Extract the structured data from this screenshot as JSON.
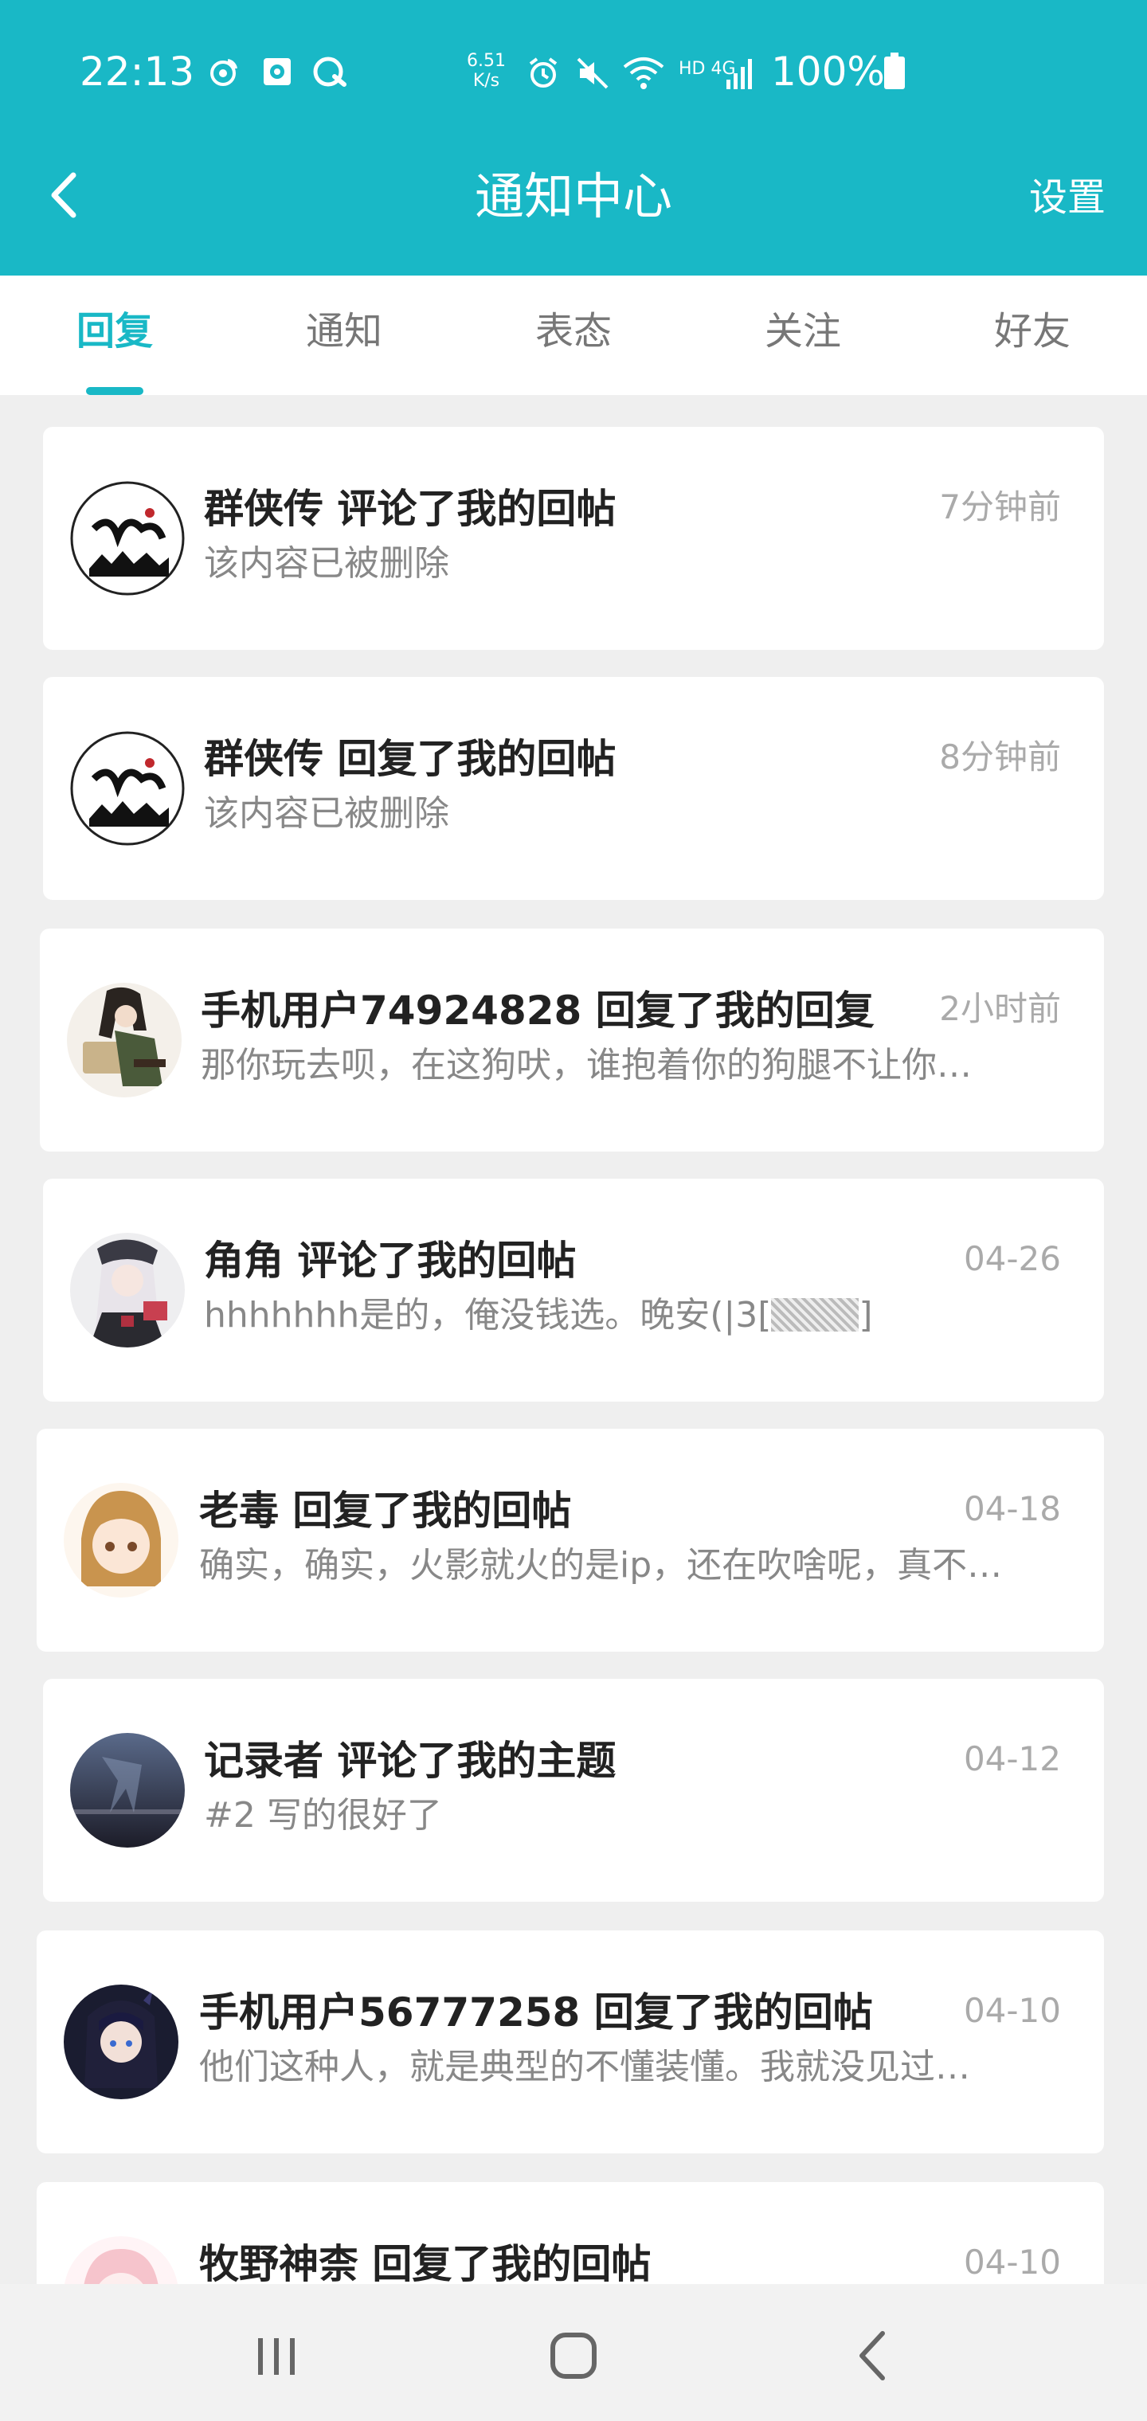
{
  "status_bar": {
    "time": "22:13",
    "net_speed_value": "6.51",
    "net_speed_unit": "K/s",
    "network_label": "HD 4G",
    "battery": "100%",
    "icons": [
      "weibo-icon",
      "gallery-icon",
      "qq-icon",
      "alarm-icon",
      "mute-icon",
      "wifi-icon",
      "signal-icon",
      "battery-icon"
    ]
  },
  "header": {
    "title": "通知中心",
    "back_icon": "chevron-left-icon",
    "settings_label": "设置"
  },
  "tabs": [
    {
      "label": "回复",
      "active": true
    },
    {
      "label": "通知",
      "active": false
    },
    {
      "label": "表态",
      "active": false
    },
    {
      "label": "关注",
      "active": false
    },
    {
      "label": "好友",
      "active": false
    }
  ],
  "notifications": [
    {
      "title": "群侠传 评论了我的回帖",
      "time": "7分钟前",
      "body": "该内容已被删除",
      "avatar": "qunxiazhuan-logo-avatar"
    },
    {
      "title": "群侠传 回复了我的回帖",
      "time": "8分钟前",
      "body": "该内容已被删除",
      "avatar": "qunxiazhuan-logo-avatar"
    },
    {
      "title": "手机用户74924828 回复了我的回复",
      "time": "2小时前",
      "body": "那你玩去呗，在这狗吠，谁抱着你的狗腿不让你…",
      "avatar": "anime-soldier-avatar"
    },
    {
      "title": "角角 评论了我的回帖",
      "time": "04-26",
      "body": "hhhhhhh是的，俺没钱选。晚安(|3[",
      "body_suffix": "]",
      "avatar": "anime-girl-white-hair-avatar"
    },
    {
      "title": "老毒 回复了我的回帖",
      "time": "04-18",
      "body": "确实，确实，火影就火的是ip，还在吹啥呢，真不…",
      "avatar": "anime-girl-brown-hair-avatar"
    },
    {
      "title": "记录者 评论了我的主题",
      "time": "04-12",
      "body": "#2 写的很好了",
      "avatar": "dark-landscape-avatar"
    },
    {
      "title": "手机用户56777258 回复了我的回帖",
      "time": "04-10",
      "body": "他们这种人，就是典型的不懂装懂。我就没见过…",
      "avatar": "anime-dark-hair-avatar"
    },
    {
      "title": "牧野神柰 回复了我的回帖",
      "time": "04-10",
      "body": "",
      "avatar": "anime-pink-avatar"
    }
  ],
  "nav_bar": {
    "icons": [
      "recent-apps-icon",
      "home-icon",
      "back-icon"
    ]
  },
  "colors": {
    "accent": "#19B8C6",
    "background": "#EFEFEF",
    "card": "#FFFFFF",
    "title_text": "#222222",
    "body_text": "#888888",
    "time_text": "#AAAAAA"
  }
}
